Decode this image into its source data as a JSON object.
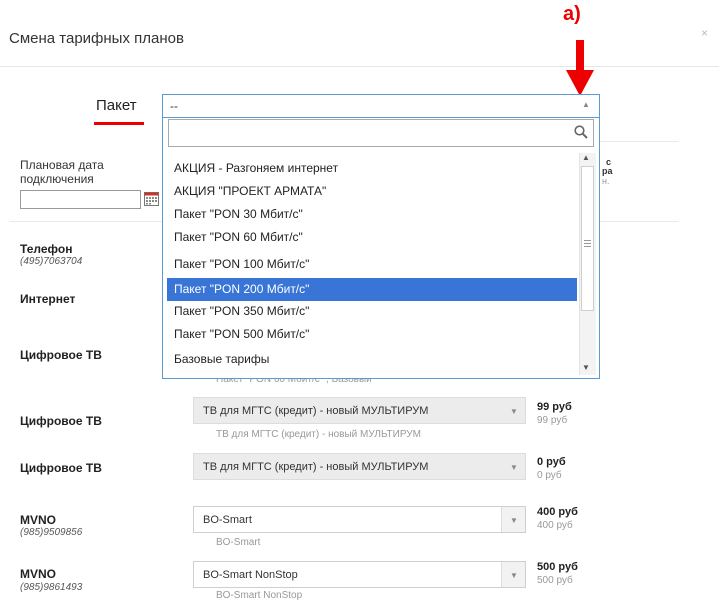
{
  "dialog": {
    "title": "Смена тарифных планов",
    "close": "×"
  },
  "annotation": {
    "label": "a)"
  },
  "package": {
    "label": "Пакет",
    "selected_value": "--",
    "search_placeholder": "",
    "options": [
      {
        "label": "АКЦИЯ - Разгоняем интернет"
      },
      {
        "label": "АКЦИЯ \"ПРОЕКТ АРМАТА\""
      },
      {
        "label": "Пакет \"PON 30 Мбит/с\""
      },
      {
        "label": "Пакет \"PON 60 Мбит/с\""
      },
      {
        "label": "Пакет \"PON 100 Мбит/с\""
      },
      {
        "label": "Пакет \"PON 200 Мбит/с\""
      },
      {
        "label": "Пакет \"PON 350 Мбит/с\""
      },
      {
        "label": "Пакет \"PON 500 Мбит/с\""
      },
      {
        "label": "Базовые тарифы"
      }
    ]
  },
  "form": {
    "date_label_line1": "Плановая дата",
    "date_label_line2": "подключения",
    "date_value": "",
    "cut_text_1": "с",
    "cut_text_2": "ра",
    "cut_text_3": "н."
  },
  "services": {
    "phone": {
      "title": "Телефон",
      "number": "(495)7063704"
    },
    "internet": {
      "title": "Интернет"
    },
    "tv1": {
      "title": "Цифровое ТВ",
      "sub": "Пакет \"PON 60 Мбит/с\" , Базовый"
    },
    "tv2": {
      "title": "Цифровое ТВ",
      "value": "ТВ для МГТС (кредит) - новый МУЛЬТИРУМ",
      "sub": "ТВ для МГТС (кредит) - новый МУЛЬТИРУМ",
      "price": "99 руб",
      "price_sub": "99 руб"
    },
    "tv3": {
      "title": "Цифровое ТВ",
      "value": "ТВ для МГТС (кредит) - новый МУЛЬТИРУМ",
      "price": "0 руб",
      "price_sub": "0 руб"
    },
    "mvno1": {
      "title": "MVNO",
      "number": "(985)9509856",
      "value": "BO-Smart",
      "sub": "BO-Smart",
      "price": "400 руб",
      "price_sub": "400 руб"
    },
    "mvno2": {
      "title": "MVNO",
      "number": "(985)9861493",
      "value": "BO-Smart NonStop",
      "sub": "BO-Smart NonStop",
      "price": "500 руб",
      "price_sub": "500 руб"
    }
  }
}
